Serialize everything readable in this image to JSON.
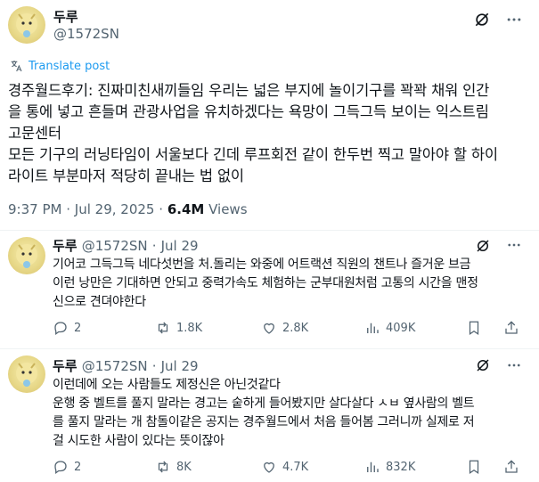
{
  "main_post": {
    "author_name": "두루",
    "author_handle": "@1572SN",
    "translate_label": "Translate post",
    "text_lines": [
      "경주월드후기: 진짜미친새끼들임 우리는 넓은 부지에 놀이기구를 꽉꽉 채워 인간",
      "을 통에 넣고 흔들며 관광사업을 유치하겠다는 욕망이 그득그득 보이는 익스트림",
      "고문센터",
      "모든 기구의 러닝타임이 서울보다 긴데 루프회전 같이 한두번 찍고 말아야 할 하이",
      "라이트 부분마저 적당히 끝내는 법 없이"
    ],
    "time": "9:37 PM",
    "date": "Jul 29, 2025",
    "views_count": "6.4M",
    "views_label": "Views",
    "separator": "·"
  },
  "replies": [
    {
      "author_name": "두루",
      "author_handle": "@1572SN",
      "date": "Jul 29",
      "text_lines": [
        "기어코 그득그득 네다섯번을 처.돌리는 와중에 어트랙션 직원의 챈트나 즐거운 브금",
        "이런 낭만은 기대하면 안되고 중력가속도 체험하는 군부대원처럼 고통의 시간을 맨정",
        "신으로 견뎌야한다"
      ],
      "replies": "2",
      "reposts": "1.8K",
      "likes": "2.8K",
      "views": "409K"
    },
    {
      "author_name": "두루",
      "author_handle": "@1572SN",
      "date": "Jul 29",
      "text_lines": [
        "이런데에 오는 사람들도 제정신은 아닌것같다",
        "운행 중 벨트를 풀지 말라는 경고는 숱하게 들어봤지만 살다살다 ㅅㅂ 옆사람의 벨트",
        "를 풀지 말라는 개 참돌이같은 공지는 경주월드에서 처음 들어봄 그러니까 실제로 저",
        "걸 시도한 사람이 있다는 뜻이잖아"
      ],
      "replies": "2",
      "reposts": "8K",
      "likes": "4.7K",
      "views": "832K"
    }
  ],
  "icons": {
    "grok": "grok-icon",
    "more": "more-icon",
    "translate": "translate-icon",
    "reply": "reply-icon",
    "repost": "repost-icon",
    "like": "like-icon",
    "views": "views-icon",
    "bookmark": "bookmark-icon",
    "share": "share-icon"
  },
  "colors": {
    "text": "#0f1419",
    "muted": "#536471",
    "link": "#1d9bf0",
    "divider": "#eff3f4"
  }
}
